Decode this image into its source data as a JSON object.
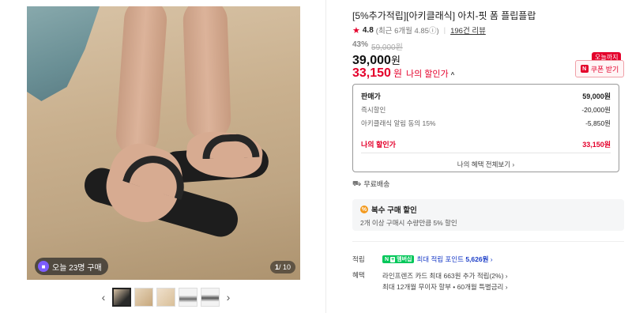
{
  "gallery": {
    "buy_badge": "오늘 23명 구매",
    "page_current": "1",
    "page_total": "/ 10",
    "prev_arrow": "‹",
    "next_arrow": "›"
  },
  "product": {
    "title": "[5%추가적립][아키클래식] 아치-핏 폼 플립플랍",
    "rating_score": "4.8",
    "rating_detail": "(최근 6개월 4.85ⓘ)",
    "review_count": "196건 리뷰",
    "discount_pct": "43%",
    "original_price": "59,000원",
    "price": "39,000",
    "price_unit": "원",
    "my_price": "33,150",
    "my_price_unit": "원",
    "my_price_label": "나의 할인가",
    "caret": "^",
    "today_tag": "오늘까지",
    "coupon_label": "쿠폰 받기",
    "coupon_badge": "N"
  },
  "breakdown": {
    "rows": [
      {
        "label": "판매가",
        "value": "59,000원"
      },
      {
        "label": "즉시할인",
        "value": "-20,000원"
      },
      {
        "label": "아키클래식 알림 동의 15%",
        "value": "-5,850원"
      }
    ],
    "mine_label": "나의 할인가",
    "mine_value": "33,150원",
    "view_all": "나의 혜택 전체보기 ›"
  },
  "shipping": {
    "icon": "⛟",
    "text": "무료배송"
  },
  "multi": {
    "icon": "%",
    "title": "복수 구매 할인",
    "desc": "2개 이상 구매시 수량만큼 5% 할인"
  },
  "points": {
    "label": "적립",
    "npay_n": "N",
    "npay_plus": "+",
    "npay_badge": "멤버십",
    "text": "최대 적립 포인트 ",
    "amount": "5,626원",
    "more": " ›"
  },
  "benefits": {
    "label": "혜택",
    "line1": "라인프렌즈 카드 최대 663원 추가 적립(2%) ›",
    "line2": "최대 12개월 무이자 할부 • 60개월 특별금리 ›"
  },
  "colors": {
    "accent_red": "#e4002b",
    "points_blue": "#1a3cc7",
    "npay_green": "#03c75a"
  }
}
